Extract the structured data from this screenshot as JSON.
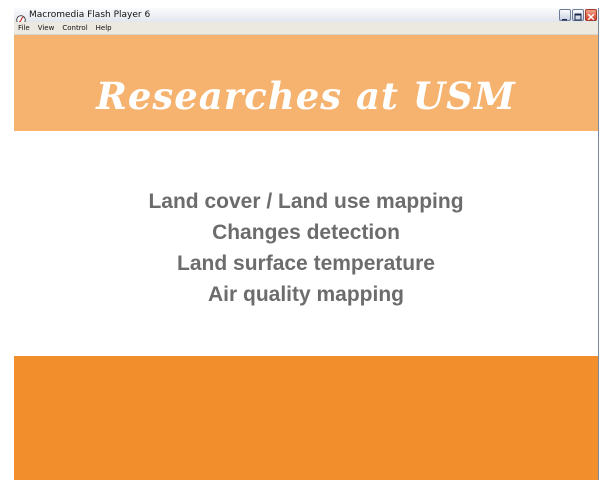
{
  "window": {
    "title": "Macromedia Flash Player 6",
    "controls": {
      "minimize": "minimize",
      "maximize": "maximize",
      "close": "close"
    }
  },
  "menu": {
    "items": [
      {
        "label": "File"
      },
      {
        "label": "View"
      },
      {
        "label": "Control"
      },
      {
        "label": "Help"
      }
    ]
  },
  "slide": {
    "heading": "Researches at USM",
    "topics": [
      "Land cover / Land use mapping",
      "Changes detection",
      "Land surface temperature",
      "Air quality mapping"
    ],
    "colors": {
      "top_band": "#f5b36f",
      "bottom_band": "#f28e2c",
      "heading": "#ffffff",
      "topic_text": "#6c6c6c"
    }
  }
}
